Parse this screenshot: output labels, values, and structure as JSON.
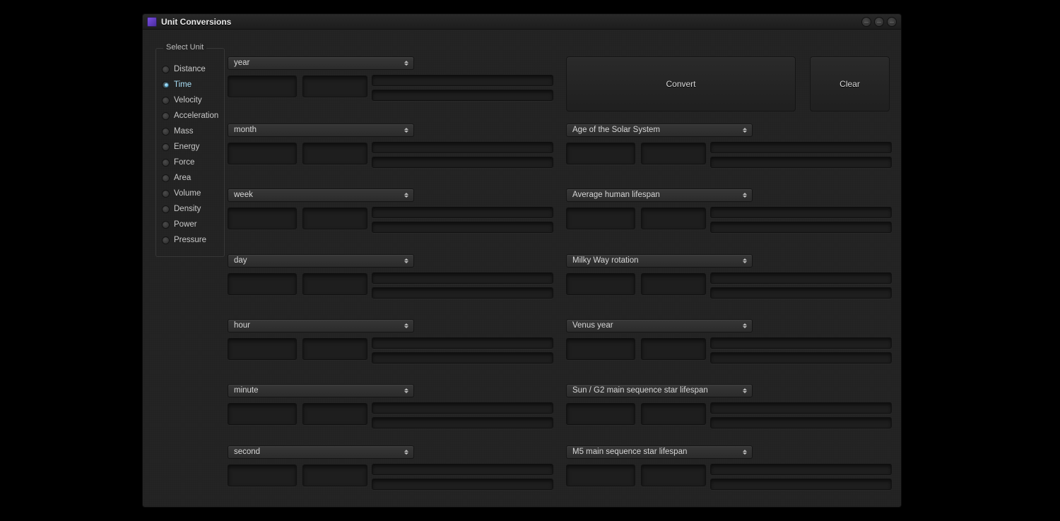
{
  "window": {
    "title": "Unit Conversions"
  },
  "sidebar": {
    "legend": "Select Unit",
    "selected": "Time",
    "items": [
      "Distance",
      "Time",
      "Velocity",
      "Acceleration",
      "Mass",
      "Energy",
      "Force",
      "Area",
      "Volume",
      "Density",
      "Power",
      "Pressure"
    ]
  },
  "buttons": {
    "convert_label": "Convert",
    "clear_label": "Clear"
  },
  "left_column": {
    "rows": [
      {
        "unit": "year"
      },
      {
        "unit": "month"
      },
      {
        "unit": "week"
      },
      {
        "unit": "day"
      },
      {
        "unit": "hour"
      },
      {
        "unit": "minute"
      },
      {
        "unit": "second"
      }
    ]
  },
  "right_column": {
    "rows": [
      {
        "unit": "Age of the Solar System"
      },
      {
        "unit": "Average human lifespan"
      },
      {
        "unit": "Milky Way rotation"
      },
      {
        "unit": "Venus year"
      },
      {
        "unit": "Sun / G2 main sequence star lifespan"
      },
      {
        "unit": "M5 main sequence star lifespan"
      }
    ]
  },
  "colors": {
    "window_bg": "#222222",
    "accent_glow": "#49b8e8"
  }
}
